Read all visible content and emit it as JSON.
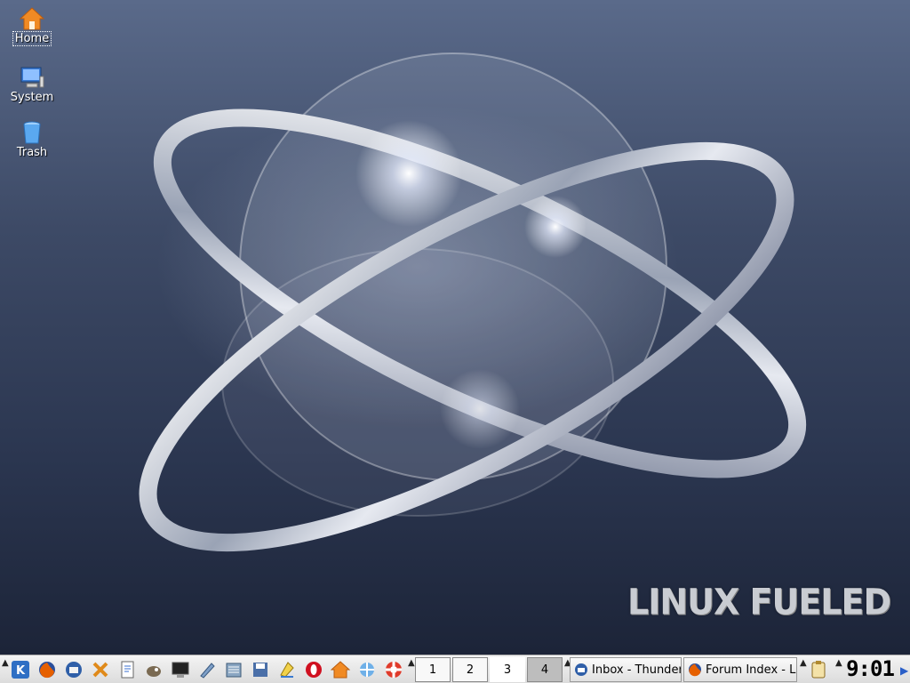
{
  "desktop": {
    "icons": [
      {
        "label": "Home",
        "icon": "home-folder-icon"
      },
      {
        "label": "System",
        "icon": "computer-icon"
      },
      {
        "label": "Trash",
        "icon": "trash-icon"
      }
    ],
    "wallpaper_text": "LINUX FUELED"
  },
  "taskbar": {
    "launchers": [
      "kde-menu-icon",
      "firefox-icon",
      "thunderbird-icon",
      "tools-icon",
      "text-editor-icon",
      "gimp-icon",
      "terminal-icon",
      "writer-icon",
      "file-manager-icon",
      "save-icon",
      "kword-icon",
      "opera-icon",
      "home-icon",
      "network-icon",
      "help-lifebuoy-icon"
    ],
    "pager": [
      "1",
      "2",
      "3",
      "4"
    ],
    "tasks": [
      {
        "label": "Inbox - Thunder",
        "icon": "thunderbird-icon"
      },
      {
        "label": "Forum Index - L",
        "icon": "firefox-icon"
      }
    ],
    "tray_icon": "klipper-icon",
    "clock": "9:01"
  },
  "colors": {
    "taskbar_bg": "#dcdcdc",
    "firefox": "#e66000",
    "thunderbird": "#2f5fa8"
  }
}
